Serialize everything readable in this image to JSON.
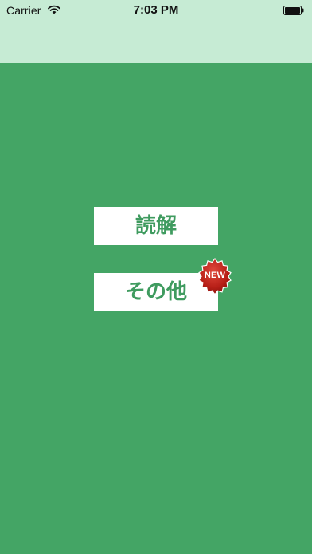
{
  "status_bar": {
    "carrier": "Carrier",
    "time": "7:03 PM",
    "wifi_icon": "wifi-icon",
    "battery_icon": "battery-icon"
  },
  "colors": {
    "background": "#44a565",
    "header": "#c6ebd4",
    "button_background": "#ffffff",
    "button_text": "#3f9b5f",
    "badge": "#c0251c"
  },
  "menu": {
    "reading_label": "読解",
    "other_label": "その他",
    "other_badge": "NEW"
  }
}
